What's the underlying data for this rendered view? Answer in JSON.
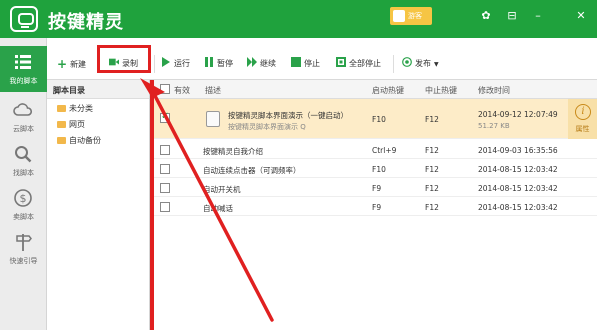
{
  "app": {
    "title": "按键精灵",
    "user": "游客"
  },
  "window_controls": [
    "✿",
    "⊟",
    "–",
    "✕"
  ],
  "leftnav": [
    {
      "label": "我的脚本",
      "icon": "list-icon"
    },
    {
      "label": "云脚本",
      "icon": "cloud-icon"
    },
    {
      "label": "找脚本",
      "icon": "search-icon"
    },
    {
      "label": "卖脚本",
      "icon": "dollar-icon"
    },
    {
      "label": "快速引导",
      "icon": "signpost-icon"
    }
  ],
  "toolbar": {
    "new": "新建",
    "record": "录制",
    "run": "运行",
    "pause": "暂停",
    "resume": "继续",
    "stop": "停止",
    "stop_all": "全部停止",
    "publish": "发布"
  },
  "directory": {
    "header": "脚本目录",
    "items": [
      "未分类",
      "网页",
      "自动备份"
    ]
  },
  "table": {
    "headers": {
      "enabled": "有效",
      "desc": "描述",
      "start_key": "启动热键",
      "stop_key": "中止热键",
      "modified": "修改时间"
    },
    "rows": [
      {
        "checked": true,
        "title": "按键精灵脚本界面演示（一键启动）",
        "subtitle": "按键精灵脚本界面演示 Q",
        "start_key": "F10",
        "stop_key": "F12",
        "modified": "2014-09-12 12:07:49",
        "size": "51.27 KB"
      },
      {
        "checked": false,
        "title": "按键精灵自我介绍",
        "start_key": "Ctrl+9",
        "stop_key": "F12",
        "modified": "2014-09-03 16:35:56"
      },
      {
        "checked": false,
        "title": "自动连续点击器（可调频率）",
        "start_key": "F10",
        "stop_key": "F12",
        "modified": "2014-08-15 12:03:42"
      },
      {
        "checked": false,
        "title": "自动开关机",
        "start_key": "F9",
        "stop_key": "F12",
        "modified": "2014-08-15 12:03:42"
      },
      {
        "checked": false,
        "title": "自动喊话",
        "start_key": "F9",
        "stop_key": "F12",
        "modified": "2014-08-15 12:03:42"
      }
    ]
  },
  "info_panel": {
    "label": "属性"
  },
  "colors": {
    "brand": "#1fa23d",
    "highlight": "#e02020",
    "selected_row": "#fdecc8"
  }
}
